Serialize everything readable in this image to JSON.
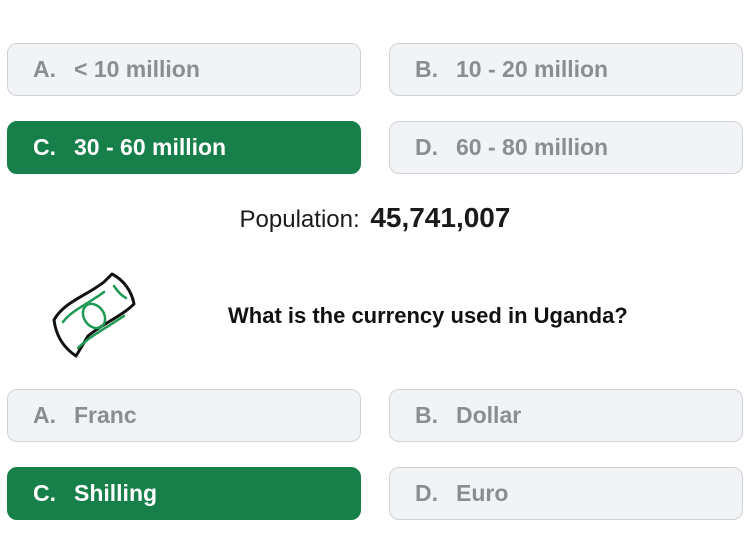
{
  "question1": {
    "options": [
      {
        "letter": "A.",
        "label": "< 10 million"
      },
      {
        "letter": "B.",
        "label": "10 - 20 million"
      },
      {
        "letter": "C.",
        "label": "30 - 60 million"
      },
      {
        "letter": "D.",
        "label": "60 - 80 million"
      }
    ],
    "selected": "C"
  },
  "population": {
    "label": "Population:",
    "value": "45,741,007"
  },
  "question2": {
    "icon": "banknote-icon",
    "text": "What is the currency used in Uganda?",
    "options": [
      {
        "letter": "A.",
        "label": "Franc"
      },
      {
        "letter": "B.",
        "label": "Dollar"
      },
      {
        "letter": "C.",
        "label": "Shilling"
      },
      {
        "letter": "D.",
        "label": "Euro"
      }
    ],
    "selected": "C"
  },
  "colors": {
    "correct": "#17804a",
    "option_bg": "#f2f3f5",
    "option_text": "#8a8d92"
  }
}
